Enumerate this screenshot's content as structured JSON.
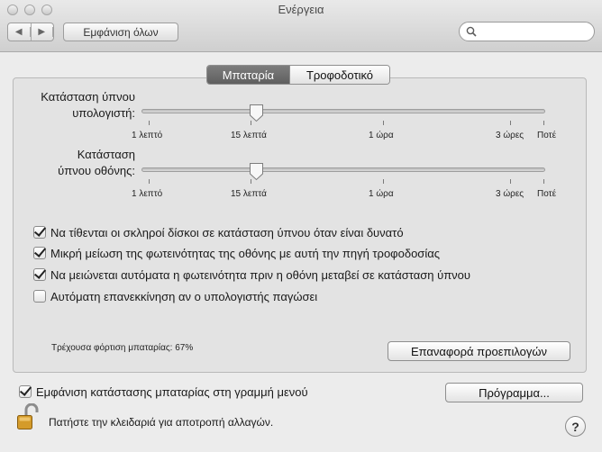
{
  "window": {
    "title": "Ενέργεια"
  },
  "toolbar": {
    "back_glyph": "◀",
    "forward_glyph": "▶",
    "show_all": "Εμφάνιση όλων",
    "search_value": ""
  },
  "tabs": [
    {
      "label": "Μπαταρία",
      "active": true
    },
    {
      "label": "Τροφοδοτικό",
      "active": false
    }
  ],
  "computer_sleep": {
    "label_line1": "Κατάσταση ύπνου",
    "label_line2": "υπολογιστή:",
    "tick_labels": [
      "1 λεπτό",
      "15 λεπτά",
      "1 ώρα",
      "3 ώρες",
      "Ποτέ"
    ],
    "value": "15 λεπτά"
  },
  "display_sleep": {
    "label_line1": "Κατάσταση",
    "label_line2": "ύπνου οθόνης:",
    "tick_labels": [
      "1 λεπτό",
      "15 λεπτά",
      "1 ώρα",
      "3 ώρες",
      "Ποτέ"
    ],
    "value": "15 λεπτά"
  },
  "options": [
    {
      "label": "Να τίθενται οι σκληροί δίσκοι σε κατάσταση ύπνου όταν είναι δυνατό",
      "checked": true
    },
    {
      "label": "Μικρή μείωση της φωτεινότητας της οθόνης με αυτή την πηγή τροφοδοσίας",
      "checked": true
    },
    {
      "label": "Να μειώνεται αυτόματα η φωτεινότητα πριν η οθόνη μεταβεί σε κατάσταση ύπνου",
      "checked": true
    },
    {
      "label": "Αυτόματη επανεκκίνηση αν ο υπολογιστής παγώσει",
      "checked": false
    }
  ],
  "battery_status": "Τρέχουσα φόρτιση μπαταρίας: 67%",
  "restore_defaults": "Επαναφορά προεπιλογών",
  "menu_bar_option": {
    "label": "Εμφάνιση κατάστασης μπαταρίας στη γραμμή μενού",
    "checked": true
  },
  "schedule_button": "Πρόγραμμα...",
  "lock_text": "Πατήστε την κλειδαριά για αποτροπή αλλαγών.",
  "help_glyph": "?",
  "colors": {
    "tab_active": "#6e6e6e",
    "panel": "#e3e3e3",
    "window": "#ececec"
  }
}
